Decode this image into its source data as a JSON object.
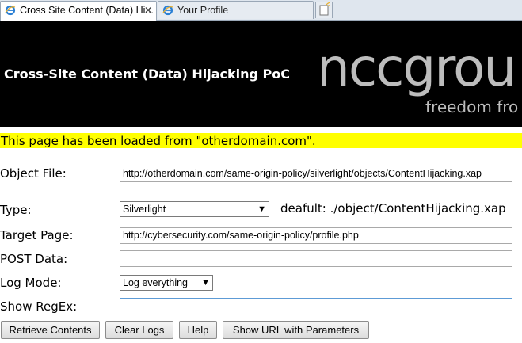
{
  "browser": {
    "tabs": [
      {
        "title": "Cross Site Content (Data) Hi...",
        "active": true
      },
      {
        "title": "Your Profile",
        "active": false
      }
    ],
    "close_glyph": "✕"
  },
  "header": {
    "title": "Cross-Site Content (Data) Hijacking PoC",
    "logo_text": "nccgrou",
    "logo_tagline": "freedom fro"
  },
  "notice": {
    "text": "This page has been loaded from \"otherdomain.com\".",
    "color": "#ffff00"
  },
  "form": {
    "object_file": {
      "label": "Object File:",
      "value": "http://otherdomain.com/same-origin-policy/silverlight/objects/ContentHijacking.xap"
    },
    "type": {
      "label": "Type:",
      "value": "Silverlight",
      "default_text": "deafult: ./object/ContentHijacking.xap"
    },
    "target_page": {
      "label": "Target Page:",
      "value": "http://cybersecurity.com/same-origin-policy/profile.php"
    },
    "post_data": {
      "label": "POST Data:",
      "value": ""
    },
    "log_mode": {
      "label": "Log Mode:",
      "value": "Log everything"
    },
    "show_regex": {
      "label": "Show RegEx:",
      "value": ""
    }
  },
  "buttons": {
    "retrieve": "Retrieve Contents",
    "clear": "Clear Logs",
    "help": "Help",
    "show_url": "Show URL with Parameters"
  }
}
